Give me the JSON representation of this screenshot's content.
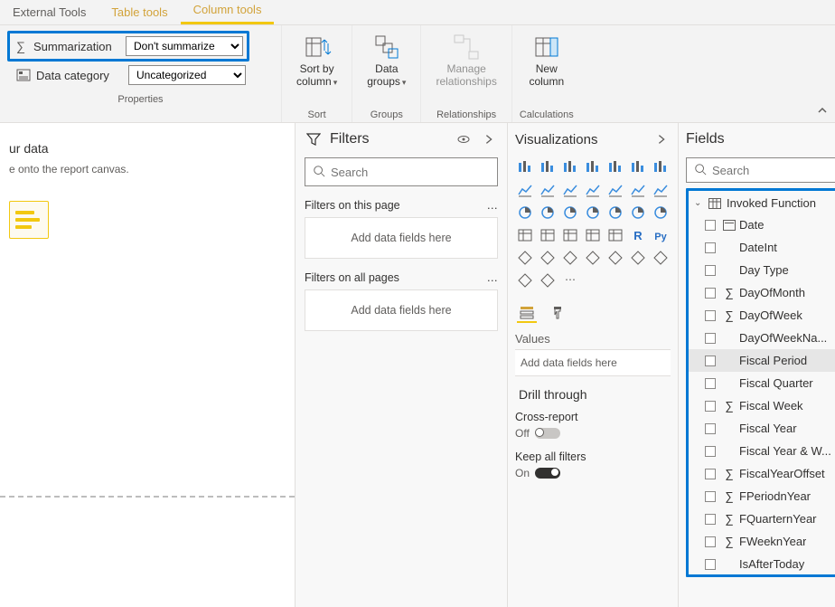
{
  "tabs": {
    "external": "External Tools",
    "table": "Table tools",
    "column": "Column tools"
  },
  "ribbon": {
    "summarization_label": "Summarization",
    "summarization_value": "Don't summarize",
    "data_category_label": "Data category",
    "data_category_value": "Uncategorized",
    "properties_group": "Properties",
    "sort": {
      "label": "Sort by\ncolumn",
      "group": "Sort"
    },
    "groups": {
      "label": "Data\ngroups",
      "group": "Groups"
    },
    "relationships": {
      "label": "Manage\nrelationships",
      "group": "Relationships"
    },
    "calculations": {
      "label": "New\ncolumn",
      "group": "Calculations"
    }
  },
  "canvas": {
    "title": "ur data",
    "sub": "e onto the report canvas."
  },
  "filters": {
    "title": "Filters",
    "search_placeholder": "Search",
    "page_label": "Filters on this page",
    "all_label": "Filters on all pages",
    "dropzone": "Add data fields here"
  },
  "viz": {
    "title": "Visualizations",
    "values_label": "Values",
    "values_drop": "Add data fields here",
    "drill_title": "Drill through",
    "cross_report": "Cross-report",
    "off": "Off",
    "keep_filters": "Keep all filters",
    "on": "On"
  },
  "fields": {
    "title": "Fields",
    "search_placeholder": "Search",
    "table": "Invoked Function",
    "items": [
      {
        "name": "Date",
        "icon": "date"
      },
      {
        "name": "DateInt",
        "icon": "none"
      },
      {
        "name": "Day Type",
        "icon": "none"
      },
      {
        "name": "DayOfMonth",
        "icon": "sigma"
      },
      {
        "name": "DayOfWeek",
        "icon": "sigma"
      },
      {
        "name": "DayOfWeekNa...",
        "icon": "none"
      },
      {
        "name": "Fiscal Period",
        "icon": "none",
        "selected": true
      },
      {
        "name": "Fiscal Quarter",
        "icon": "none"
      },
      {
        "name": "Fiscal Week",
        "icon": "sigma"
      },
      {
        "name": "Fiscal Year",
        "icon": "none"
      },
      {
        "name": "Fiscal Year & W...",
        "icon": "none"
      },
      {
        "name": "FiscalYearOffset",
        "icon": "sigma"
      },
      {
        "name": "FPeriodnYear",
        "icon": "sigma"
      },
      {
        "name": "FQuarternYear",
        "icon": "sigma"
      },
      {
        "name": "FWeeknYear",
        "icon": "sigma"
      },
      {
        "name": "IsAfterToday",
        "icon": "none"
      }
    ]
  }
}
